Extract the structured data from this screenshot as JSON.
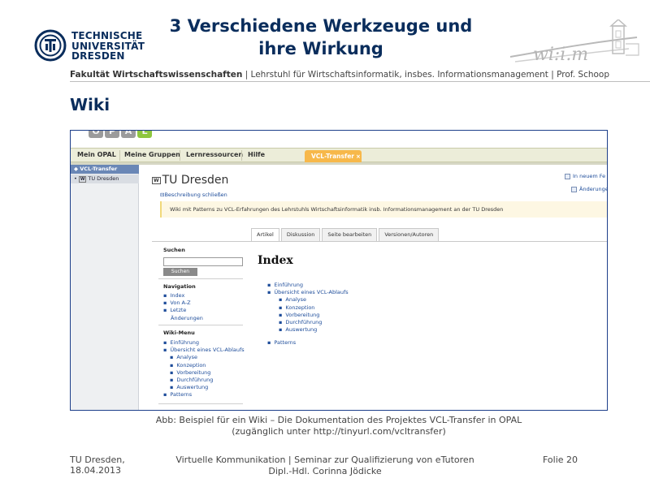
{
  "header": {
    "university_lines": [
      "TECHNISCHE",
      "UNIVERSITÄT",
      "DRESDEN"
    ],
    "title_lines": [
      "3 Verschiedene Werkzeuge und",
      "ihre Wirkung"
    ],
    "faculty": "Fakultät Wirtschaftswissenschaften",
    "chair": " | Lehrstuhl für Wirtschaftsinformatik, insbes. Informationsmanagement | Prof. Schoop",
    "section": "Wiki",
    "wiim_logo_text": "wi:i.m"
  },
  "screenshot": {
    "opal_letters": [
      "O",
      "P",
      "A",
      "L"
    ],
    "nav": [
      "Mein OPAL",
      "Meine Gruppen",
      "Lernressourcen",
      "Hilfe"
    ],
    "vcl_tab": "VCL-Transfer",
    "vcl_tab_close": "×",
    "tree_root": "VCL-Transfer",
    "tree_child": "TU Dresden",
    "tree_child_icon": "W",
    "course_title": "TU Dresden",
    "course_title_icon": "W",
    "desc_link": "Beschreibung schließen",
    "description": "Wiki mit Patterns zu VCL-Erfahrungen des Lehrstuhls Wirtschaftsinformatik insb. Informationsmanagement an der TU Dresden",
    "new_window": "In neuem Fe",
    "changes": "Änderunge",
    "tabs": [
      "Artikel",
      "Diskussion",
      "Seite bearbeiten",
      "Versionen/Autoren"
    ],
    "search_heading": "Suchen",
    "search_button": "Suchen",
    "search_value": "",
    "navigation_heading": "Navigation",
    "navigation_items": [
      "Index",
      "Von A-Z",
      "Letzte"
    ],
    "navigation_item_cont": "Änderungen",
    "wikimenu_heading": "Wiki-Menu",
    "wikimenu_items": [
      {
        "label": "Einführung",
        "level": 0
      },
      {
        "label": "Übersicht eines VCL-Ablaufs",
        "level": 0
      },
      {
        "label": "Analyse",
        "level": 1
      },
      {
        "label": "Konzeption",
        "level": 1
      },
      {
        "label": "Vorbereitung",
        "level": 1
      },
      {
        "label": "Durchführung",
        "level": 1
      },
      {
        "label": "Auswertung",
        "level": 1
      },
      {
        "label": "Patterns",
        "level": 0
      }
    ],
    "index_title": "Index",
    "index_items": [
      {
        "label": "Einführung",
        "level": 0
      },
      {
        "label": "Übersicht eines VCL-Ablaufs",
        "level": 0
      },
      {
        "label": "Analyse",
        "level": 1
      },
      {
        "label": "Konzeption",
        "level": 1
      },
      {
        "label": "Vorbereitung",
        "level": 1
      },
      {
        "label": "Durchführung",
        "level": 1
      },
      {
        "label": "Auswertung",
        "level": 1
      },
      {
        "label": "Patterns",
        "level": 0,
        "gap": true
      }
    ]
  },
  "caption_lines": [
    "Abb: Beispiel für ein Wiki – Die Dokumentation des Projektes VCL-Transfer in OPAL",
    "(zugänglich unter http://tinyurl.com/vcltransfer)"
  ],
  "footer": {
    "left_lines": [
      "TU Dresden,",
      "18.04.2013"
    ],
    "center_lines": [
      "Virtuelle Kommunikation | Seminar zur Qualifizierung von eTutoren",
      "Dipl.-Hdl. Corinna Jödicke"
    ],
    "right": "Folie 20"
  },
  "colors": {
    "tud_blue": "#0a2d5c",
    "link_blue": "#1d4c9a",
    "vcl_orange": "#f7b84a",
    "opal_green": "#8ec63f"
  }
}
